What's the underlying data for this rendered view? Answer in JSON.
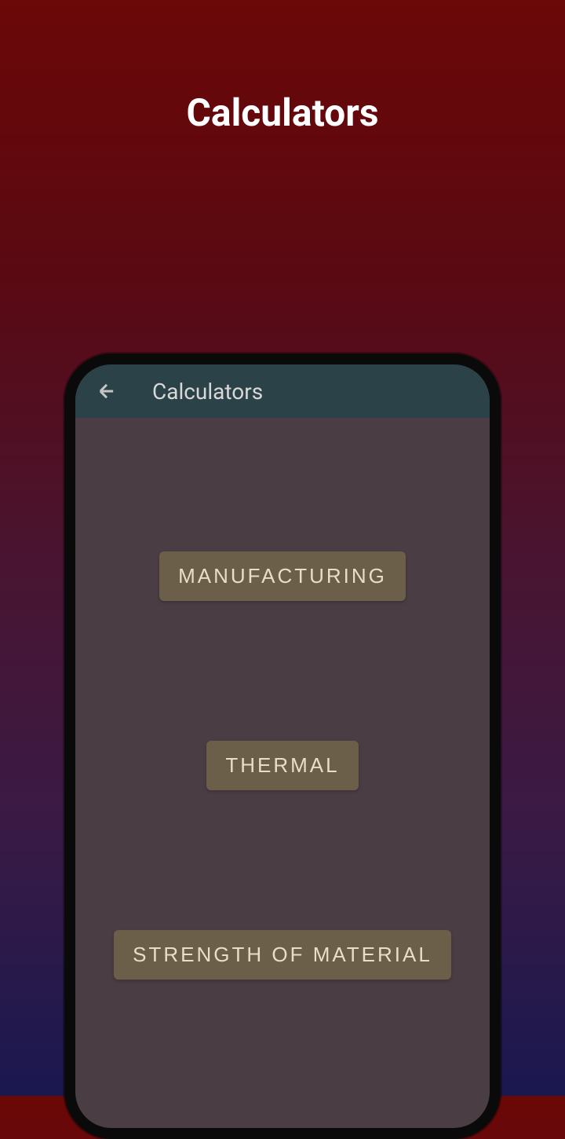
{
  "page": {
    "title": "Calculators"
  },
  "appBar": {
    "title": "Calculators"
  },
  "categories": [
    {
      "label": "MANUFACTURING"
    },
    {
      "label": "THERMAL"
    },
    {
      "label": "STRENGTH OF MATERIAL"
    }
  ]
}
